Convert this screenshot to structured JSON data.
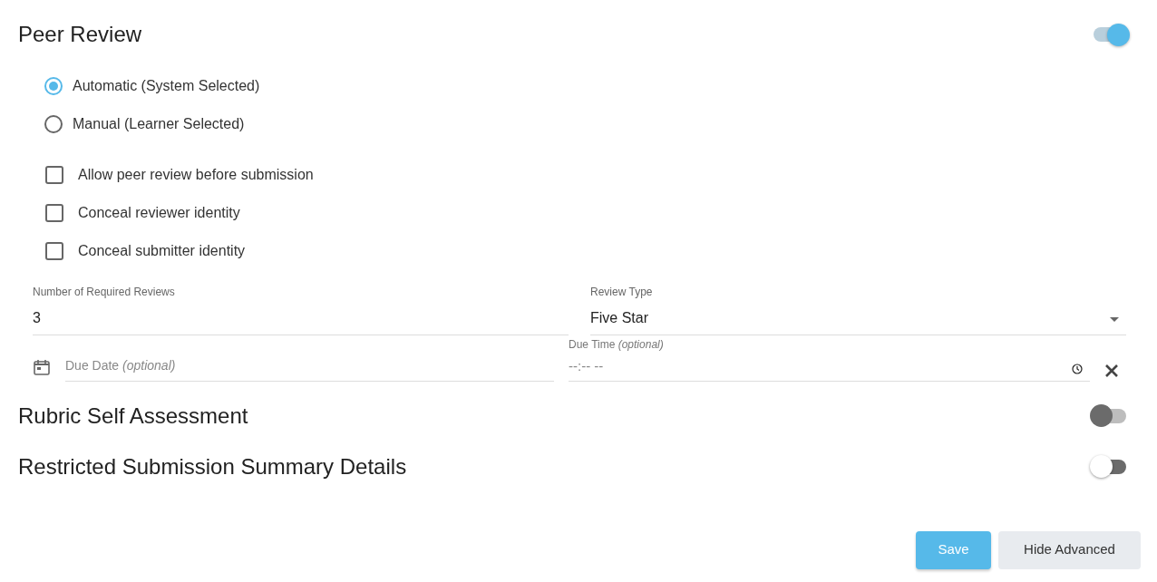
{
  "peer_review": {
    "title": "Peer Review",
    "on": true,
    "selection_options": [
      {
        "label": "Automatic (System Selected)",
        "selected": true
      },
      {
        "label": "Manual (Learner Selected)",
        "selected": false
      }
    ],
    "options": [
      {
        "label": "Allow peer review before submission",
        "checked": false
      },
      {
        "label": "Conceal reviewer identity",
        "checked": false
      },
      {
        "label": "Conceal submitter identity",
        "checked": false
      }
    ],
    "required_reviews": {
      "label": "Number of Required Reviews",
      "value": "3"
    },
    "review_type": {
      "label": "Review Type",
      "value": "Five Star"
    },
    "due_date": {
      "placeholder": "Due Date *(optional)*"
    },
    "due_time": {
      "label": "Due Time *(optional)*",
      "placeholder": "--:-- --"
    }
  },
  "sections": [
    {
      "title": "Rubric Self Assessment",
      "on": false,
      "kind": "dark"
    },
    {
      "title": "Restricted Submission Summary Details",
      "on": false,
      "kind": "light"
    }
  ],
  "buttons": [
    {
      "label": "Save",
      "kind": "primary"
    },
    {
      "label": "Hide Advanced",
      "kind": "secondary"
    }
  ]
}
